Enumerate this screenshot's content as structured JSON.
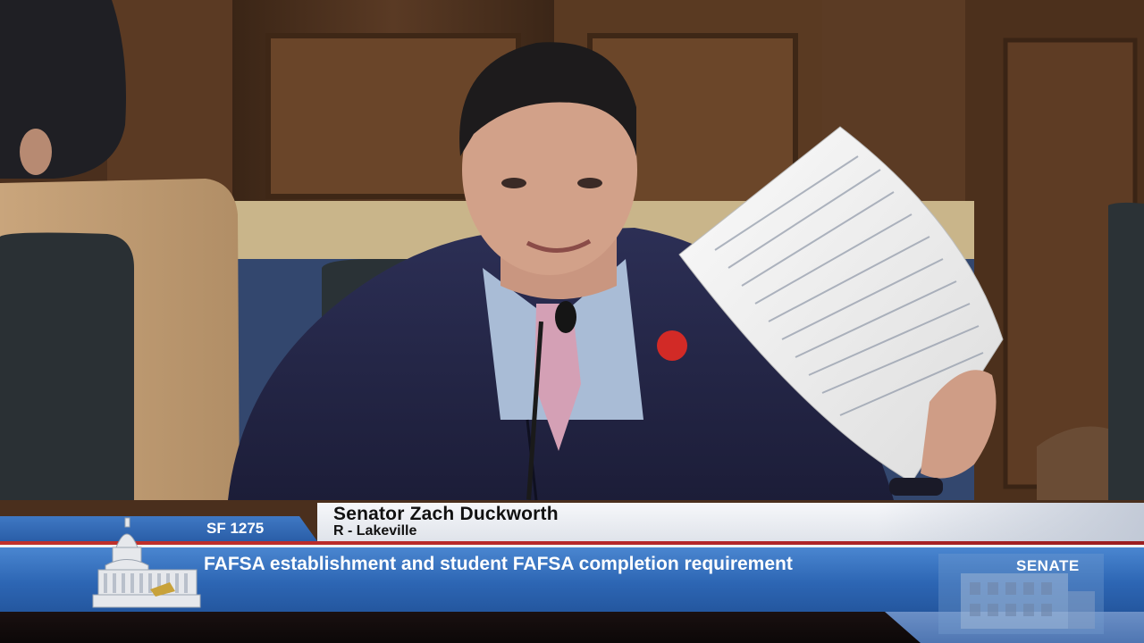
{
  "lower_third": {
    "bill_number": "SF 1275",
    "speaker_name": "Senator Zach Duckworth",
    "speaker_district": "R - Lakeville",
    "topic": "FAFSA establishment and student FAFSA completion requirement",
    "chamber_label": "SENATE"
  },
  "icons": [
    "capitol-dome-icon",
    "senate-building-icon"
  ],
  "colors": {
    "topic_bar": "#2d66b4",
    "accent_red": "#c0312b",
    "name_bar": "#eef0f4"
  }
}
